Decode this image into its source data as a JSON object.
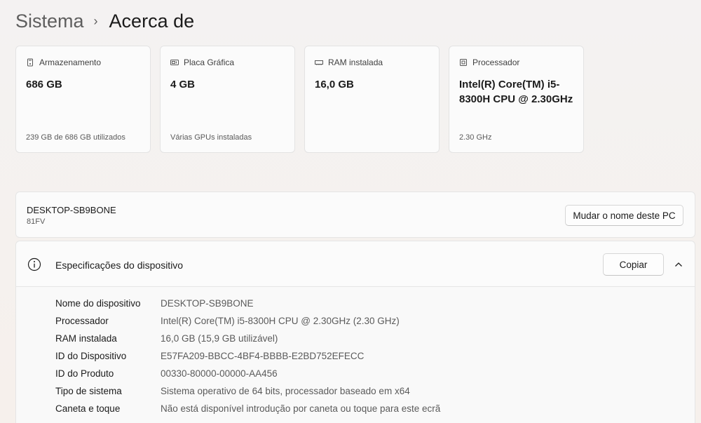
{
  "breadcrumb": {
    "parent": "Sistema",
    "separator": "›",
    "current": "Acerca de"
  },
  "cards": [
    {
      "title": "Armazenamento",
      "value": "686 GB",
      "sub": "239 GB de 686 GB utilizados",
      "icon": "storage-icon"
    },
    {
      "title": "Placa Gráfica",
      "value": "4 GB",
      "sub": "Várias GPUs instaladas",
      "icon": "gpu-icon"
    },
    {
      "title": "RAM instalada",
      "value": "16,0 GB",
      "sub": "",
      "icon": "ram-icon"
    },
    {
      "title": "Processador",
      "value": "Intel(R) Core(TM) i5-8300H CPU @ 2.30GHz",
      "sub": "2.30 GHz",
      "icon": "cpu-icon"
    }
  ],
  "device": {
    "name": "DESKTOP-SB9BONE",
    "model": "81FV",
    "rename_label": "Mudar o nome deste PC"
  },
  "specs": {
    "title": "Especificações do dispositivo",
    "copy_label": "Copiar",
    "rows": [
      {
        "label": "Nome do dispositivo",
        "value": "DESKTOP-SB9BONE"
      },
      {
        "label": "Processador",
        "value": "Intel(R) Core(TM) i5-8300H CPU @ 2.30GHz (2.30 GHz)"
      },
      {
        "label": "RAM instalada",
        "value": "16,0 GB (15,9 GB utilizável)"
      },
      {
        "label": "ID do Dispositivo",
        "value": "E57FA209-BBCC-4BF4-BBBB-E2BD752EFECC"
      },
      {
        "label": "ID do Produto",
        "value": "00330-80000-00000-AA456"
      },
      {
        "label": "Tipo de sistema",
        "value": "Sistema operativo de 64 bits, processador baseado em x64"
      },
      {
        "label": "Caneta e toque",
        "value": "Não está disponível introdução por caneta ou toque para este ecrã"
      }
    ]
  }
}
